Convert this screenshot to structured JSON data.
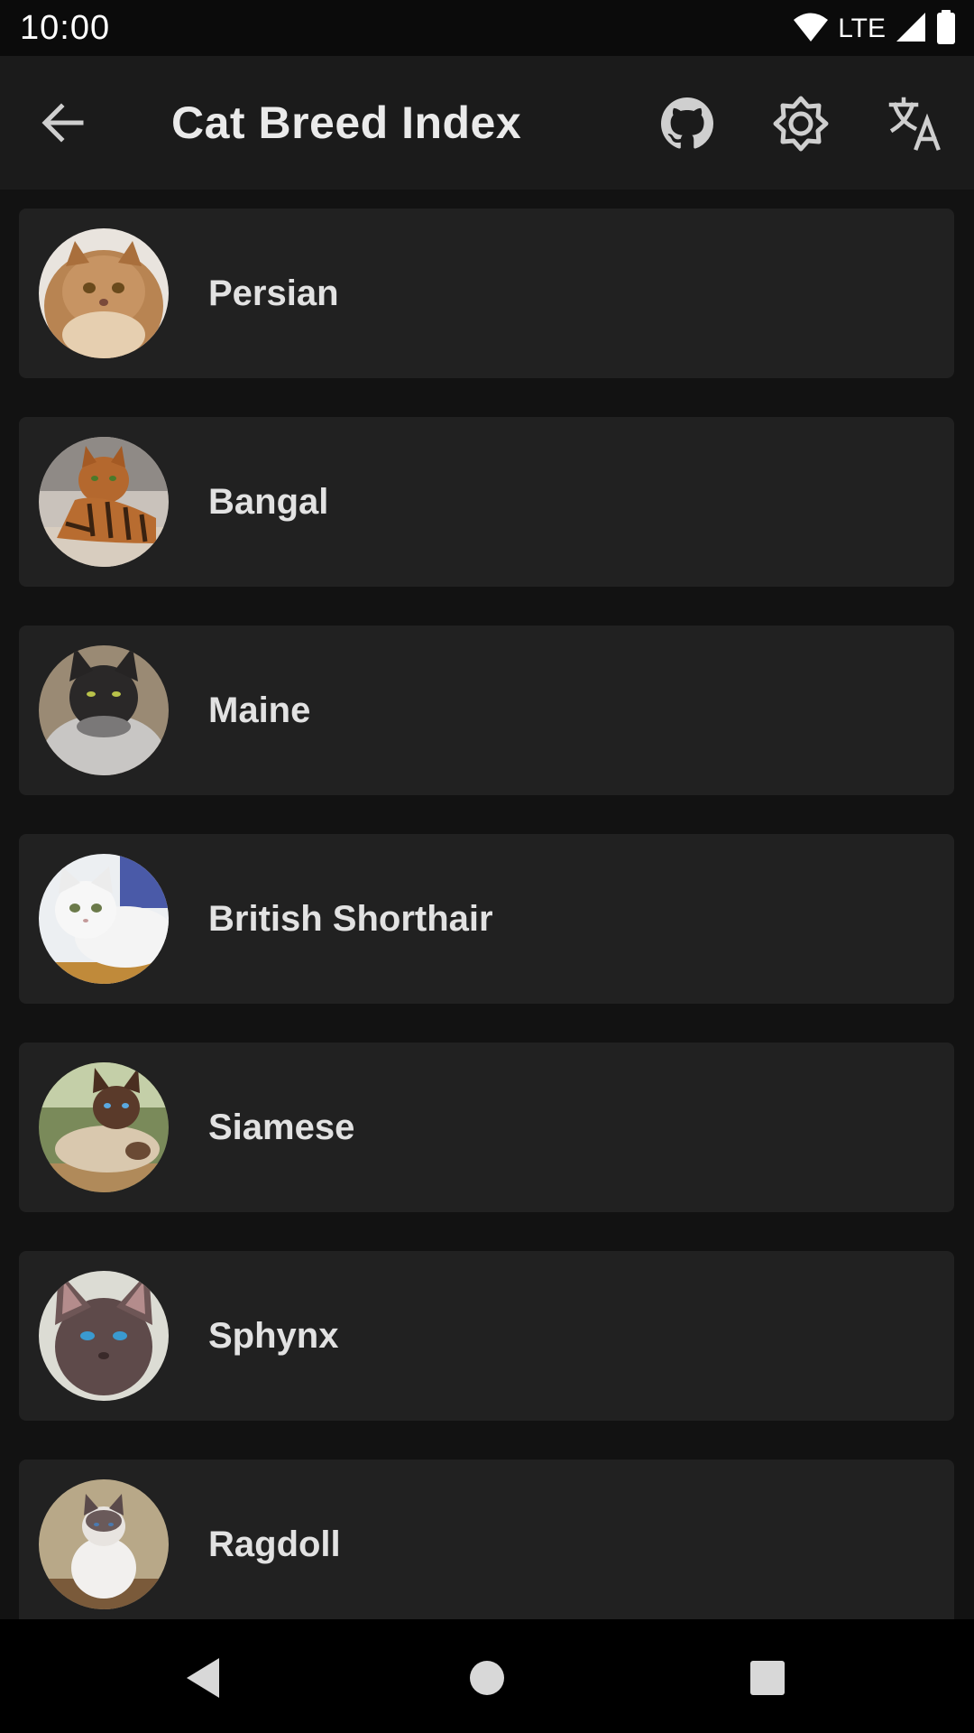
{
  "status_bar": {
    "time": "10:00",
    "network_label": "LTE",
    "icons": [
      "wifi-icon",
      "signal-icon",
      "battery-icon"
    ]
  },
  "app_bar": {
    "title": "Cat Breed Index",
    "actions": [
      "back-arrow-icon",
      "github-icon",
      "brightness-icon",
      "translate-icon"
    ]
  },
  "breeds": [
    {
      "name": "Persian"
    },
    {
      "name": "Bangal"
    },
    {
      "name": "Maine"
    },
    {
      "name": "British Shorthair"
    },
    {
      "name": "Siamese"
    },
    {
      "name": "Sphynx"
    },
    {
      "name": "Ragdoll"
    }
  ],
  "nav_bar": {
    "buttons": [
      "nav-back-icon",
      "nav-home-icon",
      "nav-recents-icon"
    ]
  },
  "colors": {
    "background": "#121212",
    "app_bar": "#1b1b1b",
    "card": "#212121",
    "text": "#e2e2e2"
  }
}
